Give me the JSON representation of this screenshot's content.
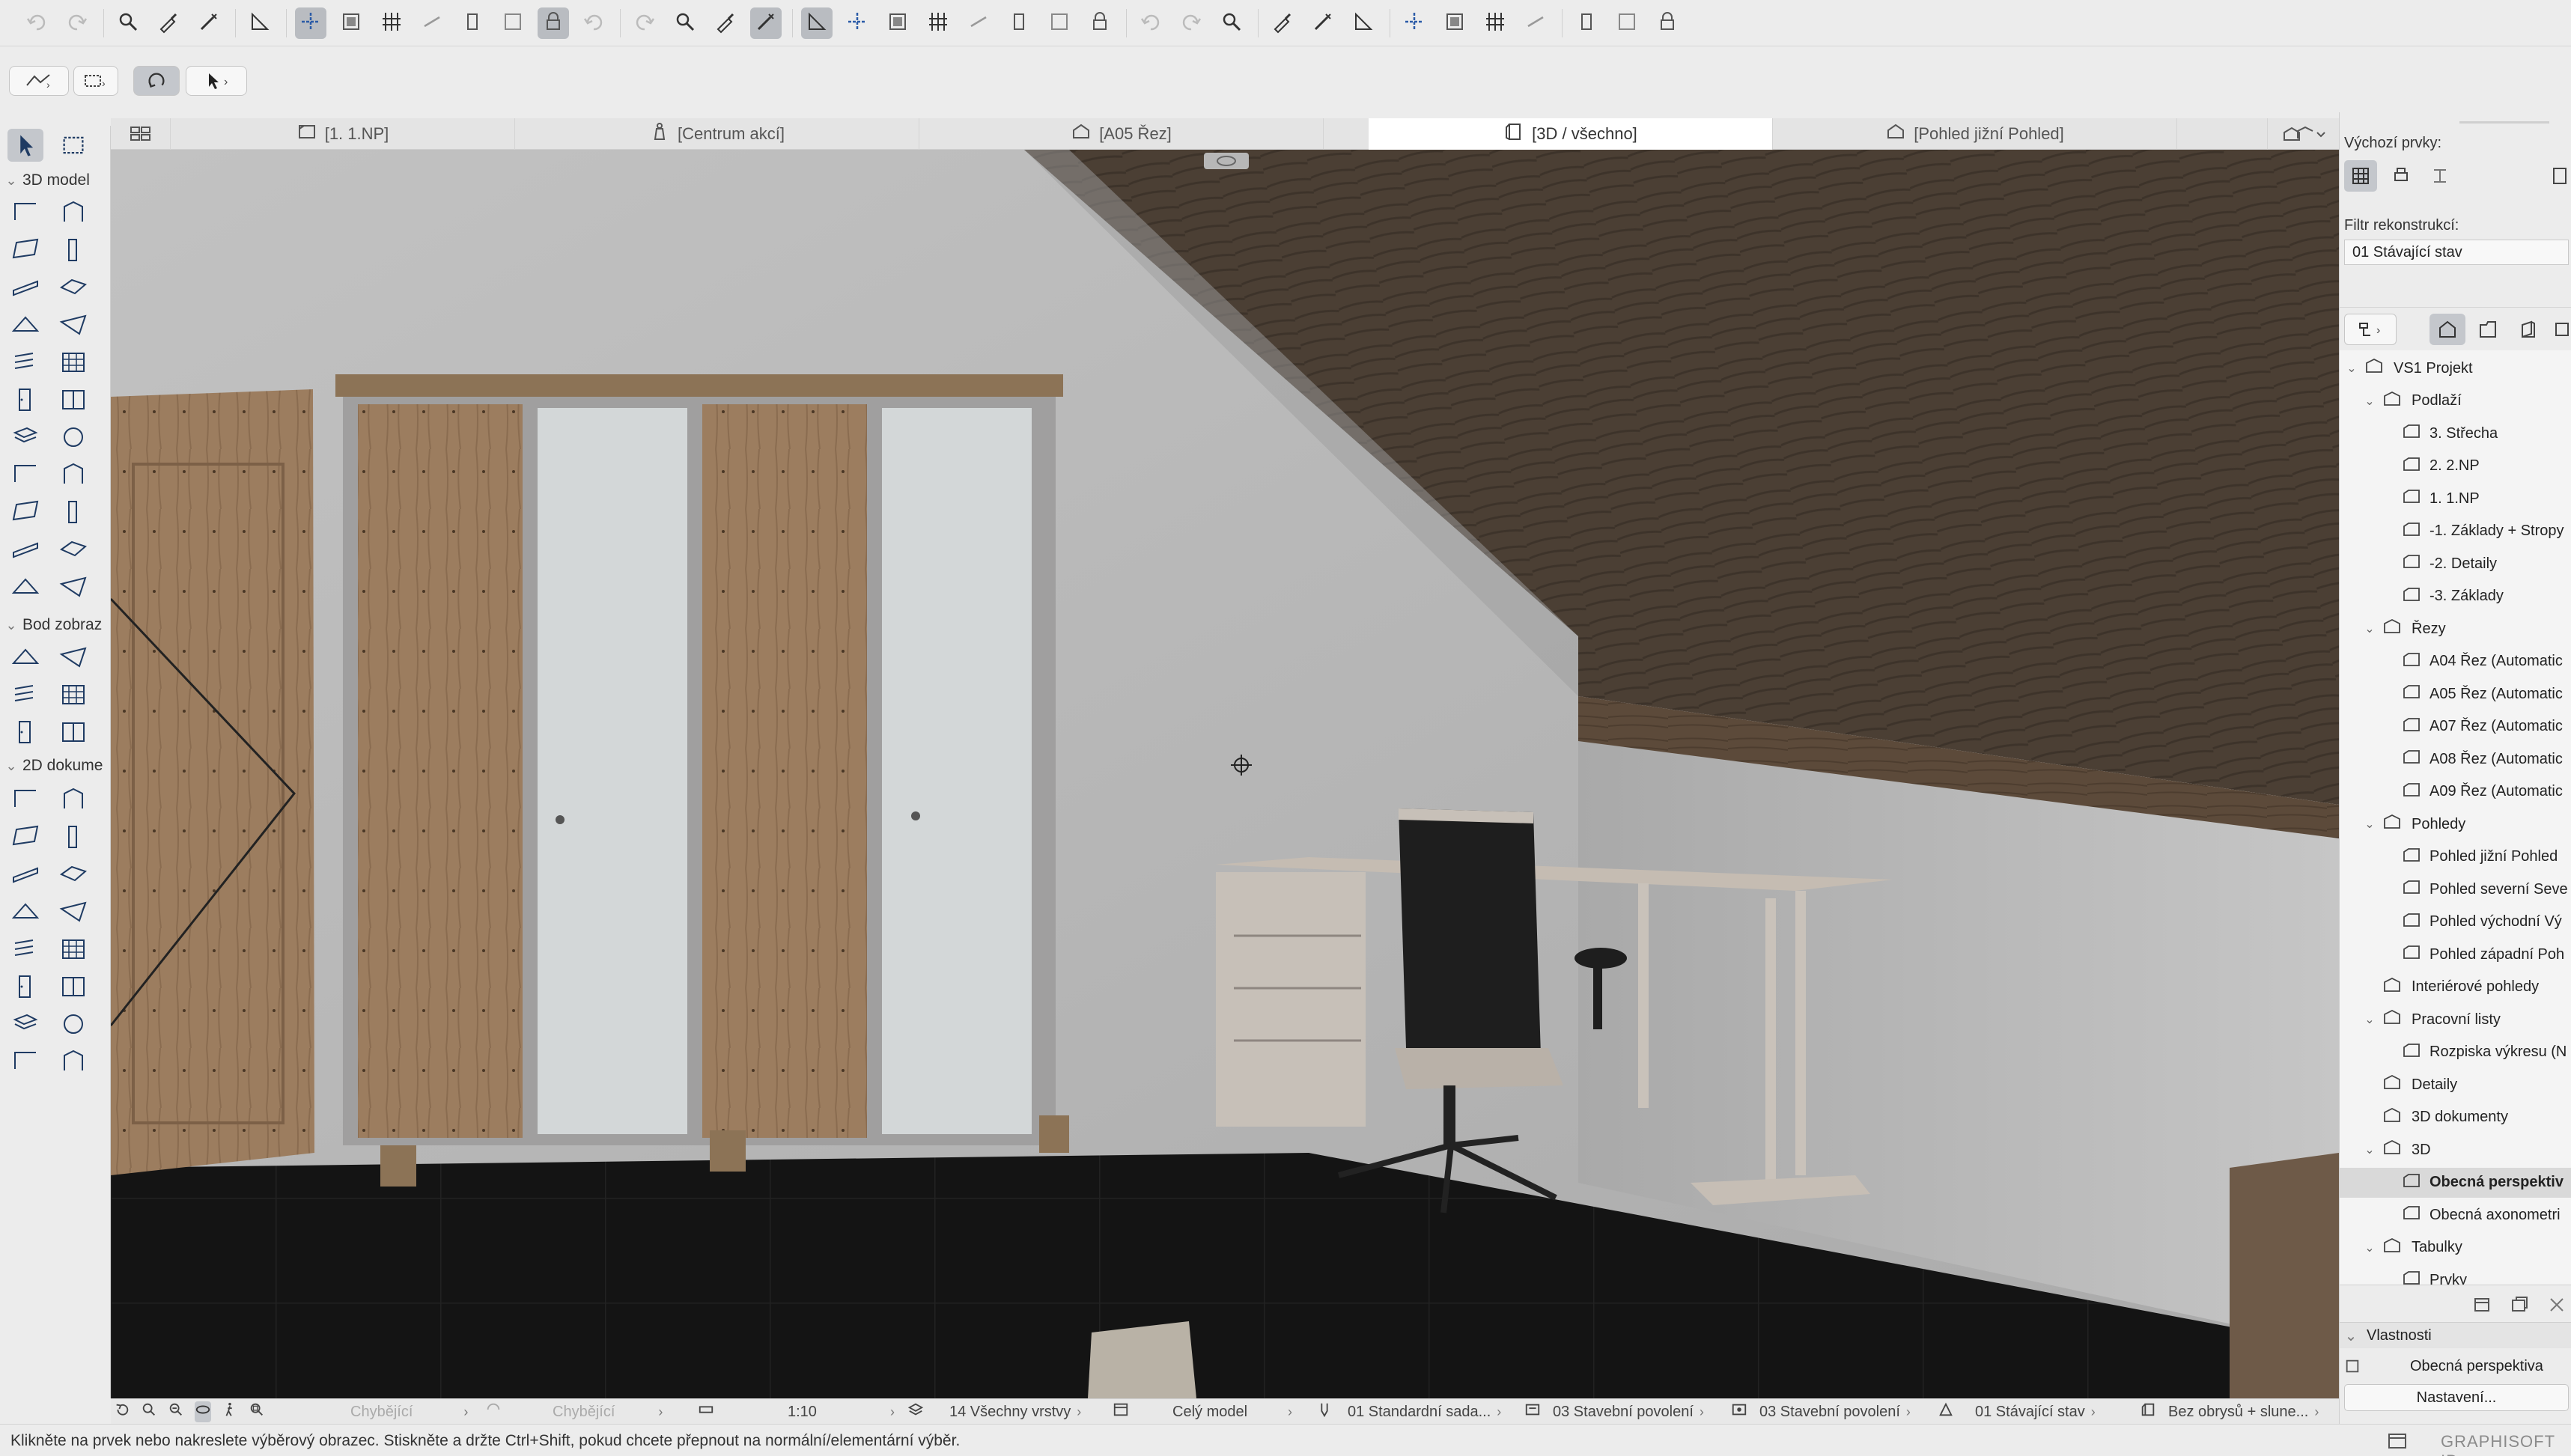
{
  "toolbar": {
    "icons": [
      "undo-icon",
      "redo-icon",
      "find-select-icon",
      "eyedropper-icon",
      "syringe-icon",
      "measure-icon",
      "snap-guides-icon",
      "grouping-icon",
      "gravity-icon",
      "trace-icon",
      "suspend-groups-icon",
      "lock-icon",
      "edit-selection-icon",
      "layers-icon",
      "explode-icon",
      "cut-plane-icon",
      "magic-wand-icon",
      "filter-icon",
      "split-icon",
      "adjust-icon",
      "trim-icon",
      "intersect-icon",
      "fillet-icon",
      "offset-icon",
      "render-icon",
      "flag-icon",
      "teamwork-icon",
      "reserve-icon",
      "show-all-icon",
      "sun-icon",
      "explore-icon",
      "publish-icon",
      "model-viewer-icon",
      "zoom-icon",
      "align-icon",
      "distribute-icon",
      "elevate-icon",
      "organizer-icon",
      "stack-icon"
    ]
  },
  "toolbar2": {
    "icons": [
      "selection-method-icon",
      "marquee-icon",
      "orbit-icon",
      "arrow-icon"
    ]
  },
  "palette": {
    "sections": [
      {
        "id": "3d",
        "label": "3D model"
      },
      {
        "id": "bod",
        "label": "Bod zobraz"
      },
      {
        "id": "2d",
        "label": "2D dokume"
      }
    ]
  },
  "tabs": [
    {
      "label": "[1. 1.NP]",
      "icon": "floor-plan-icon"
    },
    {
      "label": "[Centrum akcí]",
      "icon": "action-center-icon"
    },
    {
      "label": "[A05 Řez]",
      "icon": "section-icon"
    },
    {
      "label": "[3D / všechno]",
      "icon": "3d-view-icon",
      "active": true
    },
    {
      "label": "[Pohled jižní Pohled]",
      "icon": "elevation-icon"
    }
  ],
  "statusbar": {
    "items": [
      {
        "label": "Chybějící",
        "disabled": true
      },
      {
        "label": "Chybějící",
        "disabled": true
      },
      {
        "label": "1:10"
      },
      {
        "label": "14 Všechny vrstvy"
      },
      {
        "label": "Celý model"
      },
      {
        "label": "01 Standardní sada..."
      },
      {
        "label": "03 Stavební povolení"
      },
      {
        "label": "03 Stavební povolení"
      },
      {
        "label": "01 Stávající stav"
      },
      {
        "label": "Bez obrysů + slune..."
      }
    ]
  },
  "hint": "Klikněte na prvek nebo nakreslete výběrový obrazec. Stiskněte a držte Ctrl+Shift, pokud chcete přepnout na normální/elementární výběr.",
  "brand": "GRAPHISOFT ID",
  "right_panel": {
    "default_elements_label": "Výchozí prvky:",
    "renovation_filter_label": "Filtr rekonstrukcí:",
    "renovation_filter_value": "01 Stávající stav",
    "tree": [
      {
        "label": "VS1 Projekt",
        "level": 0,
        "twisty": "open"
      },
      {
        "label": "Podlaží",
        "level": 1,
        "twisty": "open"
      },
      {
        "label": "3. Střecha",
        "level": 2
      },
      {
        "label": "2. 2.NP",
        "level": 2
      },
      {
        "label": "1. 1.NP",
        "level": 2
      },
      {
        "label": "-1. Základy + Stropy",
        "level": 2
      },
      {
        "label": "-2. Detaily",
        "level": 2
      },
      {
        "label": "-3. Základy",
        "level": 2
      },
      {
        "label": "Řezy",
        "level": 1,
        "twisty": "open"
      },
      {
        "label": "A04 Řez (Automatic",
        "level": 2
      },
      {
        "label": "A05 Řez (Automatic",
        "level": 2
      },
      {
        "label": "A07 Řez (Automatic",
        "level": 2
      },
      {
        "label": "A08 Řez (Automatic",
        "level": 2
      },
      {
        "label": "A09 Řez (Automatic",
        "level": 2
      },
      {
        "label": "Pohledy",
        "level": 1,
        "twisty": "open"
      },
      {
        "label": "Pohled jižní Pohled",
        "level": 2
      },
      {
        "label": "Pohled severní Seve",
        "level": 2
      },
      {
        "label": "Pohled východní Vý",
        "level": 2
      },
      {
        "label": "Pohled západní Poh",
        "level": 2
      },
      {
        "label": "Interiérové pohledy",
        "level": 1
      },
      {
        "label": "Pracovní listy",
        "level": 1,
        "twisty": "open"
      },
      {
        "label": "Rozpiska výkresu (N",
        "level": 2
      },
      {
        "label": "Detaily",
        "level": 1
      },
      {
        "label": "3D dokumenty",
        "level": 1
      },
      {
        "label": "3D",
        "level": 1,
        "twisty": "open"
      },
      {
        "label": "Obecná perspektiv",
        "level": 2,
        "selected": true
      },
      {
        "label": "Obecná axonometri",
        "level": 2
      },
      {
        "label": "Tabulky",
        "level": 1,
        "twisty": "open"
      },
      {
        "label": "Prvky",
        "level": 2
      }
    ],
    "properties_label": "Vlastnosti",
    "properties_value": "Obecná perspektiva",
    "settings_button": "Nastavení..."
  }
}
